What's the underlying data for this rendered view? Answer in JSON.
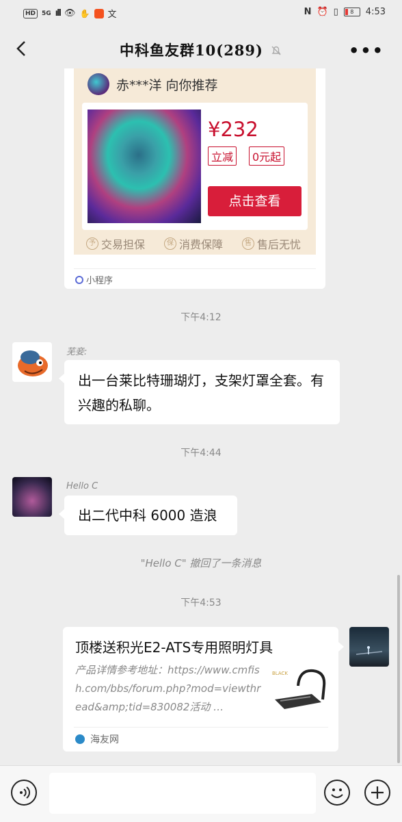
{
  "status_bar": {
    "hd": "HD",
    "net": "5G",
    "time": "4:53",
    "battery": "8"
  },
  "nav": {
    "back_icon": "chevron-left-icon",
    "title": "中科鱼友群10(289)",
    "mute_icon": "bell-off-icon",
    "more_icon": "more-icon"
  },
  "mini_program": {
    "recommender": "赤***洋 向你推荐",
    "price": "¥232",
    "tag1": "立减",
    "tag2": "0元起",
    "button": "点击查看",
    "guarantees": [
      "交易担保",
      "消费保障",
      "售后无忧"
    ],
    "label": "小程序"
  },
  "timestamps": [
    "下午4:12",
    "下午4:44",
    "下午4:53"
  ],
  "messages": [
    {
      "sender": "芜妾:",
      "text": "出一台莱比特珊瑚灯，支架灯罩全套。有兴趣的私聊。"
    },
    {
      "sender": "Hello C",
      "text": "出二代中科 6000 造浪"
    }
  ],
  "recall_notice": "\"Hello C\" 撤回了一条消息",
  "link_card": {
    "title": "顶楼送积光E2-ATS专用照明灯具",
    "description": "产品详情参考地址：https://www.cmfish.com/bbs/forum.php?mod=viewthread&amp;tid=830082活动 …",
    "source": "海友网",
    "thumb_label": "BLACK"
  },
  "input_bar": {
    "voice_icon": "voice-icon",
    "emoji_icon": "emoji-icon",
    "plus_icon": "plus-icon",
    "value": ""
  },
  "colors": {
    "accent_red": "#d81e3a",
    "price_red": "#c8102e",
    "background": "#ededed"
  }
}
